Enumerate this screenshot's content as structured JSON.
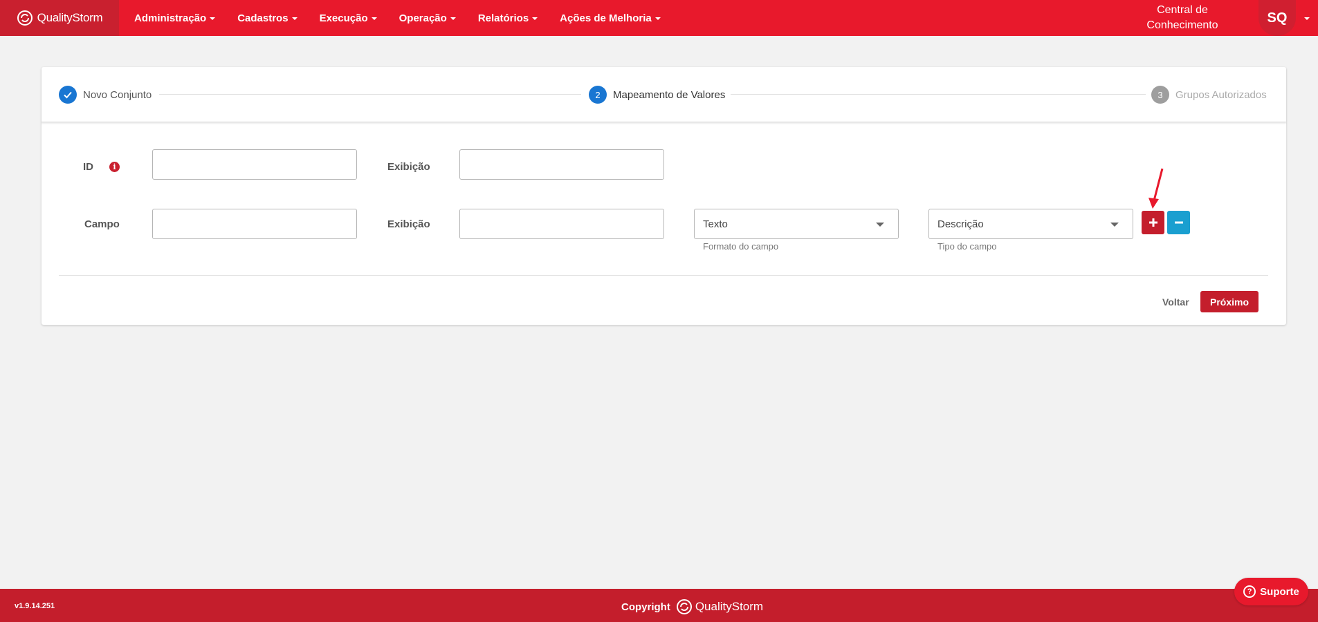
{
  "colors": {
    "brand_red": "#e8192c",
    "brand_dark_red": "#c41e2c",
    "step_blue": "#1976d2",
    "step_grey": "#9e9e9e",
    "remove_blue": "#1a9fd0"
  },
  "navbar": {
    "brand": "QualityStorm",
    "brand_icon": "quality-storm-logo-icon",
    "menu": [
      {
        "label": "Administração"
      },
      {
        "label": "Cadastros"
      },
      {
        "label": "Execução"
      },
      {
        "label": "Operação"
      },
      {
        "label": "Relatórios"
      },
      {
        "label": "Ações de Melhoria"
      }
    ],
    "knowledge_line1": "Central de",
    "knowledge_line2": "Conhecimento",
    "avatar_initials": "SQ"
  },
  "stepper": {
    "steps": [
      {
        "number": "",
        "label": "Novo Conjunto",
        "state": "completed",
        "icon": "check-icon"
      },
      {
        "number": "2",
        "label": "Mapeamento de Valores",
        "state": "active"
      },
      {
        "number": "3",
        "label": "Grupos Autorizados",
        "state": "pending"
      }
    ]
  },
  "form": {
    "id_label": "ID",
    "id_info_icon": "info-icon",
    "id_value": "",
    "display_label_1": "Exibição",
    "display_value_1": "",
    "field_label": "Campo",
    "field_value": "",
    "display_label_2": "Exibição",
    "display_value_2": "",
    "format_select": {
      "value": "Texto",
      "hint": "Formato do campo"
    },
    "type_select": {
      "value": "Descrição",
      "hint": "Tipo do campo"
    },
    "add_icon": "plus-icon",
    "remove_icon": "minus-icon"
  },
  "actions": {
    "back_label": "Voltar",
    "next_label": "Próximo"
  },
  "footer": {
    "version": "v1.9.14.251",
    "copyright_label": "Copyright",
    "brand": "QualityStorm"
  },
  "support": {
    "label": "Suporte",
    "icon": "question-circle-icon"
  }
}
